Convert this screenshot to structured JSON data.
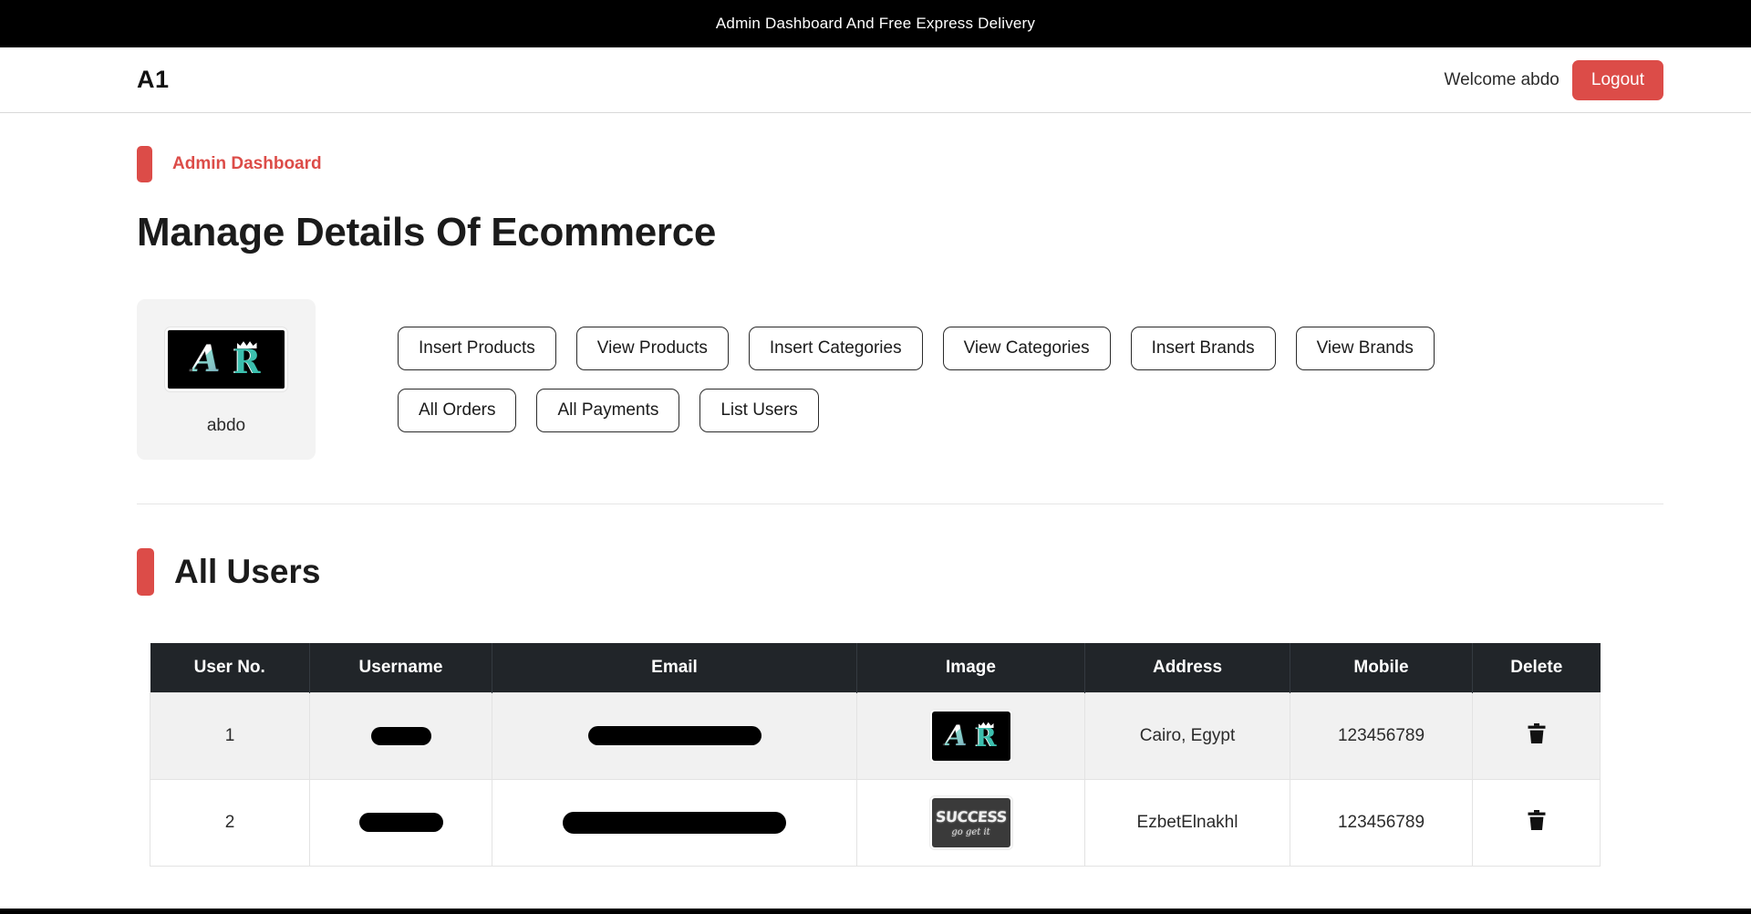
{
  "promo": {
    "text": "Admin Dashboard And Free Express Delivery"
  },
  "navbar": {
    "brand": "A1",
    "welcome": "Welcome abdo",
    "logout_label": "Logout"
  },
  "breadcrumb": {
    "label": "Admin Dashboard"
  },
  "page_title": "Manage Details Of Ecommerce",
  "profile": {
    "name": "abdo",
    "avatar_glyph_a": "A",
    "avatar_glyph_r": "R"
  },
  "actions": [
    {
      "label": "Insert Products"
    },
    {
      "label": "View Products"
    },
    {
      "label": "Insert Categories"
    },
    {
      "label": "View Categories"
    },
    {
      "label": "Insert Brands"
    },
    {
      "label": "View Brands"
    },
    {
      "label": "All Orders"
    },
    {
      "label": "All Payments"
    },
    {
      "label": "List Users"
    }
  ],
  "users_section": {
    "title": "All Users",
    "columns": [
      "User No.",
      "Username",
      "Email",
      "Image",
      "Address",
      "Mobile",
      "Delete"
    ],
    "rows": [
      {
        "no": "1",
        "username": "",
        "email": "",
        "image_kind": "ar-logo",
        "image_word": "A",
        "image_word2": "R",
        "address": "Cairo, Egypt",
        "mobile": "123456789"
      },
      {
        "no": "2",
        "username": "",
        "email": "",
        "image_kind": "chalkboard",
        "image_word": "SUCCESS",
        "image_word2": "go get it",
        "address": "EzbetElnakhl",
        "mobile": "123456789"
      }
    ]
  },
  "colors": {
    "accent_red": "#dc4c48",
    "banner_black": "#000000",
    "table_header": "#212529",
    "stripe": "#f1f1f1"
  }
}
